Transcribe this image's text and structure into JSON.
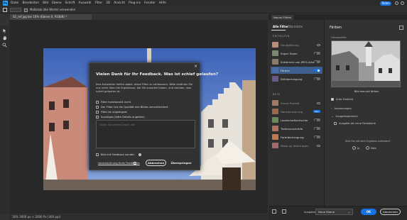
{
  "colors": {
    "accent": "#1473e6",
    "ps_logo": "#31a8ff",
    "active_filter": "#3e5f8d"
  },
  "menubar": {
    "logo": "Ps",
    "items": [
      "Datei",
      "Bearbeiten",
      "Bild",
      "Ebene",
      "Schrift",
      "Auswahl",
      "Filter",
      "3D",
      "Ansicht",
      "Plug-ins",
      "Fenster",
      "Hilfe"
    ],
    "share_label": "Teilen"
  },
  "optionsbar": {
    "checkbox_label": "Maßstab (die Werte) verwenden"
  },
  "document_tab": {
    "label": "02_ref.jpg bei 16% (Ebene 0, RGB/8) *"
  },
  "statusbar": {
    "text": "16%     3000 px × 2000 Px (300 ppi)"
  },
  "dialog": {
    "close": "×",
    "title": "Vielen Dank für Ihr Feedback. Was ist schief gelaufen?",
    "body": "Ihre Antworten helfen dabei, diese Filter zu verbessern. Bitte erzählen Sie uns mehr über die Ergebnisse, die Sie erwartet haben, und darüber, was schief gelaufen ist.",
    "options": [
      "Filter funktioniert nicht",
      "Der Filter hat die Qualität des Bildes verschlechtert",
      "Filter ist ungeeignet",
      "Sonstiges (bitte Details angeben)"
    ],
    "textarea_placeholder": "Geben Sie weitere Details hier",
    "attach_label": "Bild mit Feedback senden",
    "preview_link": "Vorschauhrung Ihres Feedbacks",
    "cancel_label": "Abbrechen",
    "skip_label": "Überspringen"
  },
  "neural_filters": {
    "tab_label": "Neural Filters",
    "tabs": [
      "Alle Filter",
      "Warteliste"
    ],
    "section_enthalten": "ENTHALTEN",
    "section_beta": "BETA",
    "featured": [
      {
        "name": "Hautglättung",
        "state": "cloud"
      },
      {
        "name": "Super Zoom",
        "state": "off"
      },
      {
        "name": "Entfernen von JPEG-Arte...",
        "state": "off"
      },
      {
        "name": "Färben",
        "state": "on"
      },
      {
        "name": "Stilübertragung",
        "state": "off"
      }
    ],
    "beta": [
      {
        "name": "Smart Porträt",
        "state": "cloud"
      },
      {
        "name": "Harmonisierung",
        "state": "badge",
        "badge": "Neu"
      },
      {
        "name": "Landschaftsmischer",
        "state": "off"
      },
      {
        "name": "Tiefenunschärfe",
        "state": "off"
      },
      {
        "name": "Farbübertragung",
        "state": "off"
      },
      {
        "name": "Make-up übertragen",
        "state": "cloud"
      }
    ],
    "right": {
      "title": "Färben",
      "reference_label": "Fokuspunkte",
      "caption": "Bild manuell färben",
      "auto_color": "Auto-Farbbild",
      "section1": "Anpassungen",
      "section2": "Ausgabeoptionen",
      "output_checkbox": "Ausgabe als neue Farbebene",
      "question": "Sind Sie mit dem Ergebnis zufrieden?",
      "yes": "Ja",
      "no": "Nein"
    },
    "bottom": {
      "output_label": "Ausgabe",
      "output_value": "Neue Ebene",
      "ok_label": "OK",
      "cancel_label": "Abbrechen"
    }
  }
}
